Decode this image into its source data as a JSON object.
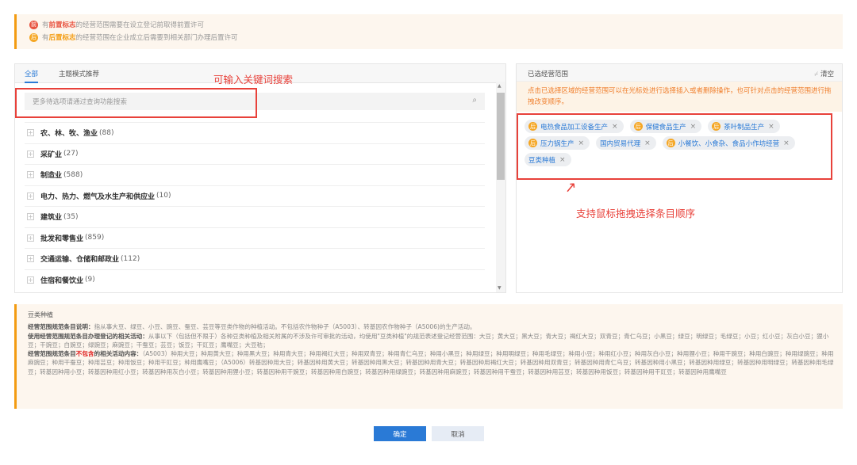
{
  "notice": {
    "pre": {
      "badge": "前",
      "a": "有",
      "hl": "前置标志",
      "b": "的经营范围需要在设立登记前取得前置许可"
    },
    "post": {
      "badge": "后",
      "a": "有",
      "hl": "后置标志",
      "b": "的经营范围在企业成立后需要到相关部门办理后置许可"
    }
  },
  "left": {
    "tabs": [
      "全部",
      "主题模式推荐"
    ],
    "annotation": "可输入关键词搜索",
    "search_placeholder": "更多待选项请通过查询功能搜索",
    "tree": [
      {
        "label": "农、林、牧、渔业",
        "count": "(88)"
      },
      {
        "label": "采矿业",
        "count": "(27)"
      },
      {
        "label": "制造业",
        "count": "(588)"
      },
      {
        "label": "电力、热力、燃气及水生产和供应业",
        "count": "(10)"
      },
      {
        "label": "建筑业",
        "count": "(35)"
      },
      {
        "label": "批发和零售业",
        "count": "(859)"
      },
      {
        "label": "交通运输、仓储和邮政业",
        "count": "(112)"
      },
      {
        "label": "住宿和餐饮业",
        "count": "(9)"
      }
    ]
  },
  "right": {
    "title": "已选经营范围",
    "clear": "清空",
    "tip": "点击已选择区域的经营范围可以在光标处进行选择插入或者删除操作，也可针对点击的经营范围进行拖拽改变顺序。",
    "tags": [
      {
        "label": "电热食品加工设备生产",
        "badge": "后"
      },
      {
        "label": "保健食品生产",
        "badge": "后"
      },
      {
        "label": "茶叶制品生产",
        "badge": "后"
      },
      {
        "label": "压力锅生产",
        "badge": "后"
      },
      {
        "label": "国内贸易代理",
        "badge": ""
      },
      {
        "label": "小餐饮、小食杂、食品小作坊经营",
        "badge": "后"
      },
      {
        "label": "豆类种植",
        "badge": ""
      }
    ],
    "annotation": "支持鼠标拖拽选择条目顺序"
  },
  "detail": {
    "title": "豆类种植",
    "l1_label": "经营范围规范条目说明：",
    "l1": "指从事大豆、绿豆、小豆、豌豆、蚕豆、芸豆等豆类作物的种植活动。不包括农作物种子（A5003）、转基因农作物种子（A5006)的生产活动。",
    "l2_label": "使用经营范围规范条目办理登记的相关活动：",
    "l2": "从事以下（包括但不限于）各种豆类种植及相关附属的不涉及许可审批的活动，均使用\"豆类种植\"的规范表述登记经营范围：大豆；黄大豆；黑大豆；青大豆；褐红大豆；双青豆；青仁乌豆；小黑豆；绿豆；明绿豆；毛绿豆；小豆；红小豆；灰白小豆；狸小豆；干豌豆；白豌豆；绿豌豆；麻豌豆；干蚕豆；芸豆；饭豆；干豇豆；鹰嘴豆；大豆秸；",
    "l3_a": "经营范围规范条目",
    "l3_red": "不包含",
    "l3_b": "的相关活动内容：",
    "l3": "（A5003）种用大豆；种用黄大豆；种用黑大豆；种用青大豆；种用褐红大豆；种用双青豆；种用青仁乌豆；种用小黑豆；种用绿豆；种用明绿豆；种用毛绿豆；种用小豆；种用红小豆；种用灰白小豆；种用狸小豆；种用干豌豆；种用白豌豆；种用绿豌豆；种用麻豌豆；种用干蚕豆；种用芸豆；种用饭豆；种用干豇豆；种用鹰嘴豆；（A5006）转基因种用大豆；转基因种用黄大豆；转基因种用黑大豆；转基因种用青大豆；转基因种用褐红大豆；转基因种用双青豆；转基因种用青仁乌豆；转基因种用小黑豆；转基因种用绿豆；转基因种用明绿豆；转基因种用毛绿豆；转基因种用小豆；转基因种用红小豆；转基因种用灰白小豆；转基因种用狸小豆；转基因种用干豌豆；转基因种用白豌豆；转基因种用绿豌豆；转基因种用麻豌豆；转基因种用干蚕豆；转基因种用芸豆；转基因种用饭豆；转基因种用干豇豆；转基因种用鹰嘴豆"
  },
  "buttons": {
    "ok": "确定",
    "cancel": "取消"
  }
}
